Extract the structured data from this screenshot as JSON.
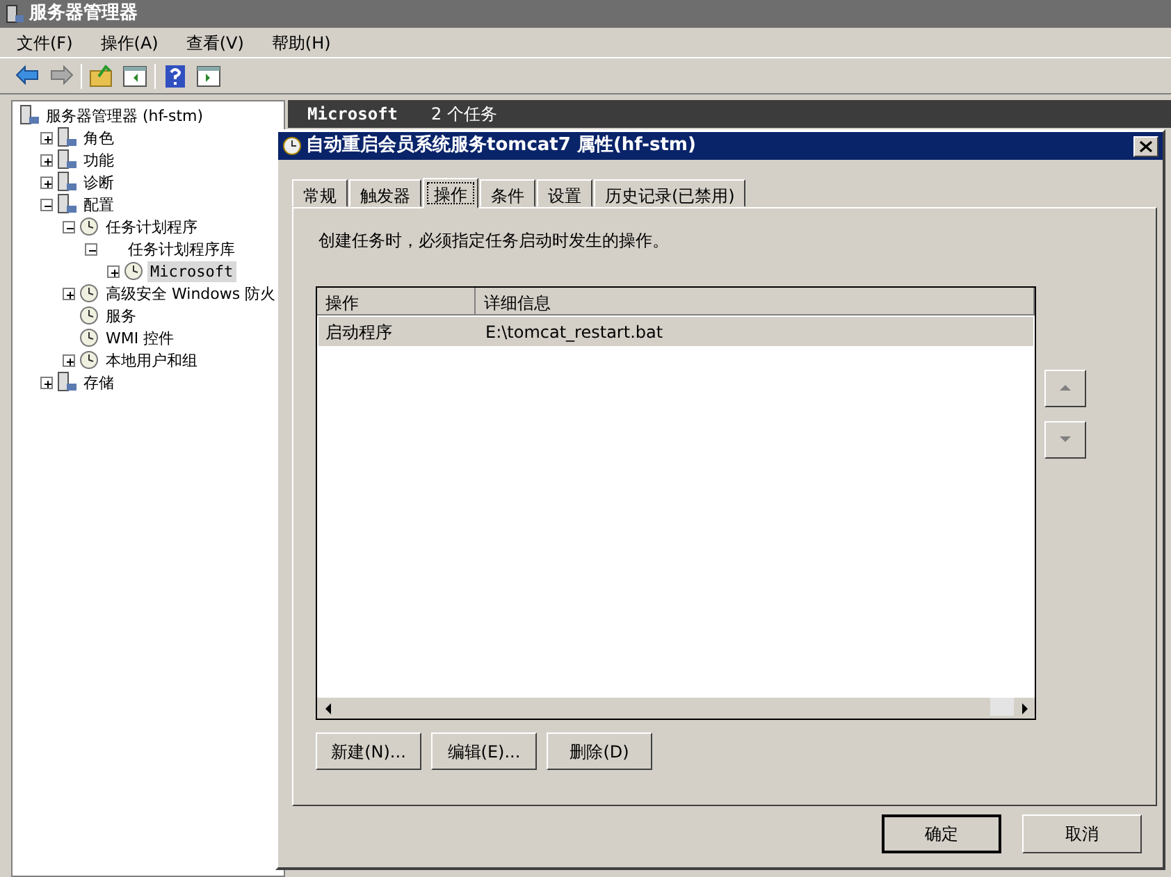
{
  "window": {
    "title": "服务器管理器"
  },
  "menu": [
    "文件(F)",
    "操作(A)",
    "查看(V)",
    "帮助(H)"
  ],
  "tree": [
    {
      "label": "服务器管理器 (hf-stm)",
      "has_icon": true,
      "selected": false,
      "children": [
        {
          "label": "角色",
          "expanded": false,
          "has_icon": true,
          "selected": false
        },
        {
          "label": "功能",
          "expanded": false,
          "has_icon": true,
          "selected": false
        },
        {
          "label": "诊断",
          "expanded": false,
          "has_icon": true,
          "selected": false
        },
        {
          "label": "配置",
          "expanded": true,
          "has_icon": true,
          "selected": false,
          "children": [
            {
              "label": "任务计划程序",
              "expanded": true,
              "has_icon": true,
              "selected": false,
              "children": [
                {
                  "label": "任务计划程序库",
                  "expanded": true,
                  "has_icon": false,
                  "selected": false,
                  "children": [
                    {
                      "label": "Microsoft",
                      "expanded": false,
                      "has_icon": true,
                      "selected": true
                    }
                  ]
                }
              ]
            },
            {
              "label": "高级安全 Windows 防火",
              "expanded": false,
              "has_icon": true,
              "selected": false
            },
            {
              "label": "服务",
              "has_icon": true,
              "selected": false
            },
            {
              "label": "WMI 控件",
              "has_icon": true,
              "selected": false
            },
            {
              "label": "本地用户和组",
              "expanded": false,
              "has_icon": true,
              "selected": false
            }
          ]
        },
        {
          "label": "存储",
          "expanded": false,
          "has_icon": true,
          "selected": false
        }
      ]
    }
  ],
  "right_pane": {
    "header_title": "Microsoft",
    "header_count": "2 个任务"
  },
  "dialog": {
    "title": "自动重启会员系统服务tomcat7 属性(hf-stm)",
    "tabs": [
      {
        "label": "常规",
        "selected": false
      },
      {
        "label": "触发器",
        "selected": false
      },
      {
        "label": "操作",
        "selected": true
      },
      {
        "label": "条件",
        "selected": false
      },
      {
        "label": "设置",
        "selected": false
      },
      {
        "label": "历史记录(已禁用)",
        "selected": false
      }
    ],
    "description": "创建任务时，必须指定任务启动时发生的操作。",
    "table": {
      "columns": [
        "操作",
        "详细信息"
      ],
      "rows": [
        {
          "cells": [
            "启动程序",
            "E:\\tomcat_restart.bat"
          ],
          "selected": true
        }
      ]
    },
    "move_buttons": [
      {
        "kind": "up",
        "disabled": true
      },
      {
        "kind": "down",
        "disabled": true
      }
    ],
    "action_buttons": [
      "新建(N)...",
      "编辑(E)...",
      "删除(D)"
    ],
    "footer_buttons": [
      {
        "label": "确定",
        "default": true
      },
      {
        "label": "取消",
        "default": false
      }
    ]
  }
}
